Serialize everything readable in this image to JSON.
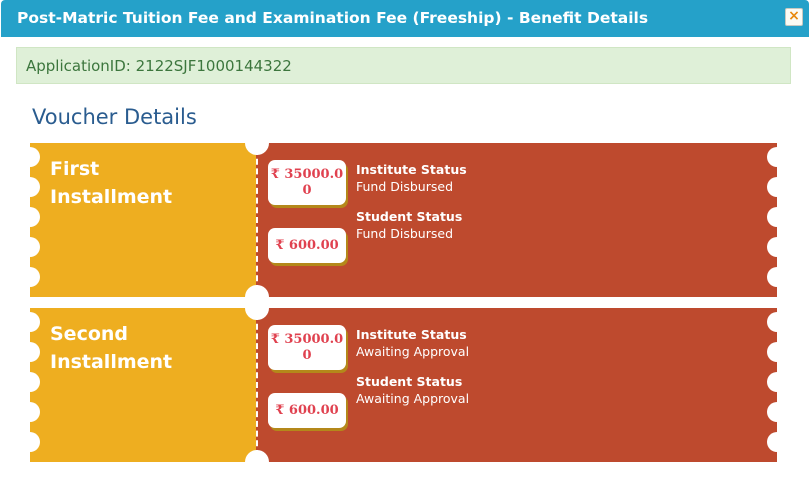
{
  "dialog": {
    "title": "Post-Matric Tuition Fee and Examination Fee (Freeship) - Benefit Details",
    "close_icon": "×"
  },
  "application": {
    "label": "ApplicationID: 2122SJF1000144322"
  },
  "section": {
    "title": "Voucher Details"
  },
  "currency_symbol": "₹",
  "vouchers": [
    {
      "installment_line1": "First",
      "installment_line2": "Installment",
      "amount_institute": "35000.0​0",
      "amount_student": "600.00",
      "institute_status_label": "Institute Status",
      "institute_status": "Fund Disbursed",
      "student_status_label": "Student Status",
      "student_status": "Fund Disbursed"
    },
    {
      "installment_line1": "Second",
      "installment_line2": "Installment",
      "amount_institute": "35000.0​0",
      "amount_student": "600.00",
      "institute_status_label": "Institute Status",
      "institute_status": "Awaiting Approval",
      "student_status_label": "Student Status",
      "student_status": "Awaiting Approval"
    }
  ],
  "colors": {
    "header": "#25a1c9",
    "stub": "#eeae20",
    "ticket": "#be4a2e",
    "amount_text": "#e0414f",
    "app_bg": "#dff0d8"
  }
}
